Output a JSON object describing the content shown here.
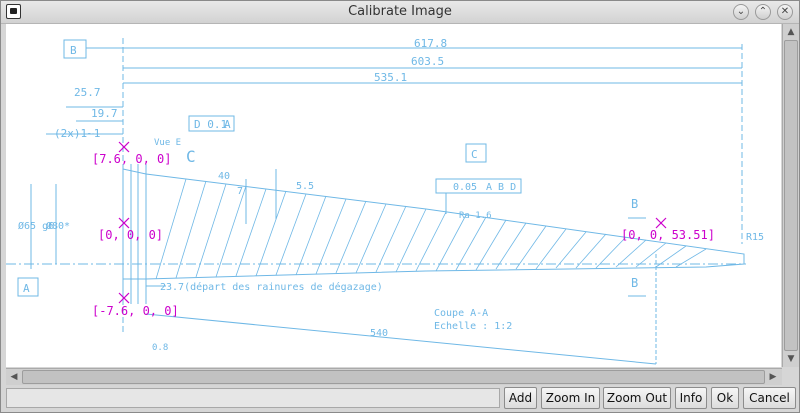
{
  "window": {
    "title": "Calibrate Image"
  },
  "titlebar_buttons": [
    "⌄",
    "⌃",
    "✕"
  ],
  "drawing": {
    "box_label_b": "B",
    "box_label_a": "A",
    "box_label_c": "C",
    "dim_617": "617.8",
    "dim_603": "603.5",
    "dim_535": "535.1",
    "dim_25": "25.7",
    "dim_19": "19.7",
    "dim_2x1": "(2x)1~1",
    "tol_d01": "D 0.1",
    "tol_d01_ref": "A",
    "vue_e": "Vue E",
    "letter_c": "C",
    "dim_40": "40",
    "dim_7": "7",
    "dim_5_5": "5.5",
    "tol_005": "0.05",
    "tol_005_refs": "A B D",
    "ra": "Ra 1.6",
    "b_top": "B",
    "b_bottom": "B",
    "r15": "R15",
    "dim_phi_65": "Ø65 g6",
    "dim_phi_80": "Ø80*",
    "depart": "23.7(départ des rainures de dégazage)",
    "coupe": "Coupe A-A",
    "echelle": "Echelle :  1:2",
    "dim_540": "540",
    "dim_0_8": "0.8"
  },
  "markers": [
    {
      "label": "[7.6, 0, 0]",
      "color": "#cc00cc"
    },
    {
      "label": "[0, 0, 0]",
      "color": "#cc00cc"
    },
    {
      "label": "[-7.6, 0, 0]",
      "color": "#cc00cc"
    },
    {
      "label": "[0, 0, 53.51]",
      "color": "#cc00cc"
    }
  ],
  "buttons": {
    "add": "Add",
    "zoom_in": "Zoom In",
    "zoom_out": "Zoom Out",
    "info": "Info",
    "ok": "Ok",
    "cancel": "Cancel"
  },
  "scroll_arrows": {
    "up": "▲",
    "down": "▼",
    "left": "◀",
    "right": "▶"
  },
  "colors": {
    "drawing_line": "#6fb8e6",
    "marker": "#cc00cc"
  }
}
